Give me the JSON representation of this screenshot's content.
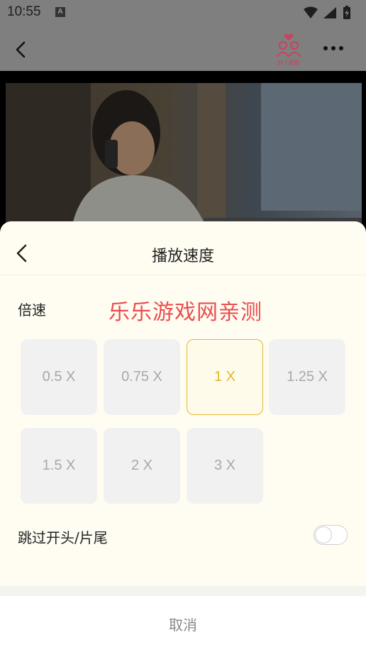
{
  "status_bar": {
    "time": "10:55",
    "badge": "A",
    "icons": [
      "wifi-icon",
      "signal-icon",
      "battery-charging-icon"
    ]
  },
  "header": {
    "logo_text": "妙人视影",
    "icons": [
      "back-icon",
      "more-icon"
    ]
  },
  "sheet": {
    "title": "播放速度",
    "speed_label": "倍速",
    "watermark": "乐乐游戏网亲测",
    "speeds": [
      "0.5 X",
      "0.75 X",
      "1 X",
      "1.25 X",
      "1.5 X",
      "2 X",
      "3 X"
    ],
    "selected_speed": "1 X",
    "skip_label": "跳过开头/片尾",
    "skip_enabled": false,
    "cancel_label": "取消"
  },
  "colors": {
    "accent": "#e2b634",
    "watermark": "#ea4d4d",
    "sheet_bg": "#fffdf2",
    "logo": "#c9435e"
  }
}
